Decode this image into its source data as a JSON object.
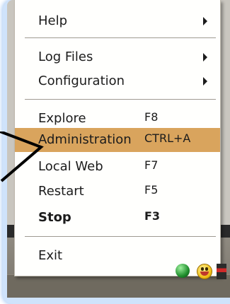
{
  "menu": {
    "items": [
      {
        "label": "Help",
        "shortcut": "",
        "submenu": true
      },
      {
        "label": "Log Files",
        "shortcut": "",
        "submenu": true
      },
      {
        "label": "Configuration",
        "shortcut": "",
        "submenu": true
      },
      {
        "label": "Explore",
        "shortcut": "F8",
        "submenu": false
      },
      {
        "label": "Administration",
        "shortcut": "CTRL+A",
        "submenu": false,
        "highlighted": true
      },
      {
        "label": "Local Web",
        "shortcut": "F7",
        "submenu": false
      },
      {
        "label": "Restart",
        "shortcut": "F5",
        "submenu": false
      },
      {
        "label": "Stop",
        "shortcut": "F3",
        "submenu": false,
        "bold": true
      },
      {
        "label": "Exit",
        "shortcut": "",
        "submenu": false
      }
    ],
    "highlight_color": "#d9a45d"
  },
  "tray": {
    "icons": [
      "green-status-icon",
      "smiley-messenger-icon",
      "flag-icon"
    ]
  }
}
